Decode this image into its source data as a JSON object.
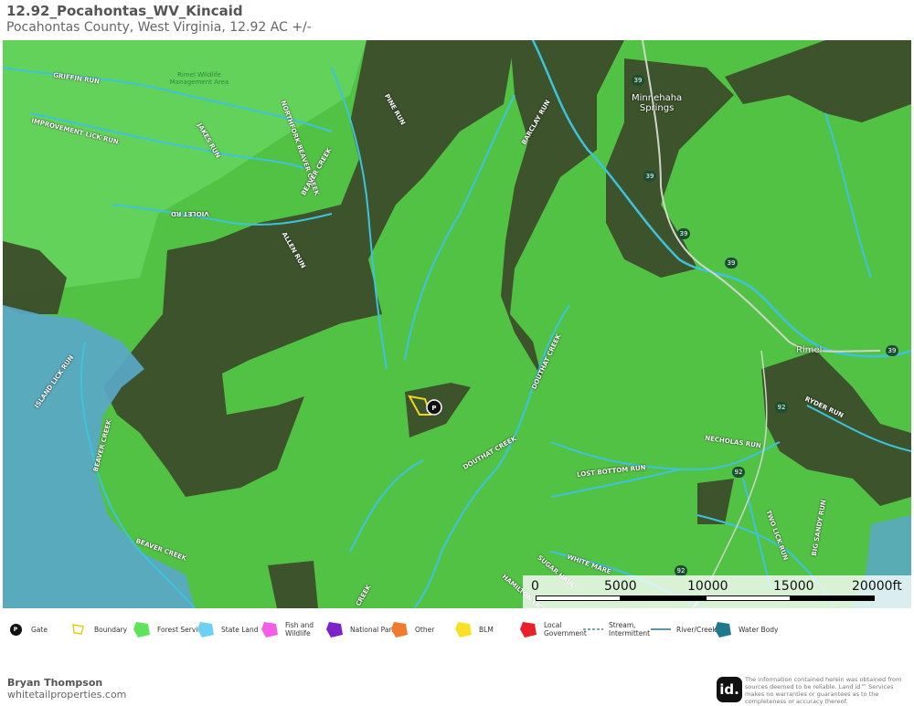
{
  "header": {
    "title": "12.92_Pocahontas_WV_Kincaid",
    "subtitle": "Pocahontas County, West Virginia, 12.92 AC +/-"
  },
  "map": {
    "area_label": "Rimel Wildlife\nManagement Area",
    "place_labels": {
      "minnehaha": "Minnehaha\nSprings",
      "rimel": "Rimel"
    },
    "road_shields": [
      "39",
      "39",
      "39",
      "39",
      "39",
      "92",
      "92",
      "92"
    ],
    "stream_labels": [
      "GRIFFIN RUN",
      "IMPROVEMENT LICK RUN",
      "JAKES RUN",
      "NORTHFORK BEAVER CREEK",
      "BEAVER CREEK",
      "PINE RUN",
      "BARCLAY RUN",
      "ALLEN RUN",
      "VIOLET RD",
      "DOUTHAT CREEK",
      "DOUTHAT CREEK",
      "ISLAND LICK RUN",
      "BEAVER CREEK",
      "BEAVER CREEK",
      "RYDER RUN",
      "NECHOLAS RUN",
      "LOST BOTTOM RUN",
      "TWO LICK RUN",
      "BIG SANDY RUN",
      "WHITE MARE",
      "SUGAR HAUL",
      "HAMILTON LICK",
      "CREEK"
    ],
    "colors": {
      "forest_service": "#4fd14a",
      "state_land": "#5ab8e0",
      "river": "#3ec3dd",
      "boundary": "#f0d81a"
    }
  },
  "scale_bar": {
    "labels": [
      "0",
      "5000",
      "10000",
      "15000",
      "20000ft"
    ]
  },
  "legend": [
    {
      "label": "Gate",
      "icon": "gate-icon"
    },
    {
      "label": "Boundary",
      "icon": "boundary-icon"
    },
    {
      "label": "Forest Servic",
      "icon": "forest-service-icon",
      "color": "#5ee35a"
    },
    {
      "label": "State Land",
      "icon": "state-land-icon",
      "color": "#6fd0f5"
    },
    {
      "label": "Fish and\nWildlife",
      "icon": "fish-wildlife-icon",
      "color": "#f45ee6"
    },
    {
      "label": "National Parl",
      "icon": "national-park-icon",
      "color": "#7b22c8"
    },
    {
      "label": "Other",
      "icon": "other-icon",
      "color": "#f07a2e"
    },
    {
      "label": "BLM",
      "icon": "blm-icon",
      "color": "#f9e12a"
    },
    {
      "label": "Local\nGovernment",
      "icon": "local-government-icon",
      "color": "#e8202a"
    },
    {
      "label": "Stream,\nIntermittent",
      "icon": "stream-intermittent-icon"
    },
    {
      "label": "River/Creek",
      "icon": "river-creek-icon"
    },
    {
      "label": "Water Body",
      "icon": "water-body-icon",
      "color": "#1d7a8c"
    }
  ],
  "footer": {
    "agent_name": "Bryan Thompson",
    "website": "whitetailproperties.com",
    "logo_text": "id.",
    "disclaimer": "The information contained herein was obtained from sources deemed to be reliable. Land id™ Services makes no warranties or guarantees as to the completeness or accuracy thereof."
  }
}
